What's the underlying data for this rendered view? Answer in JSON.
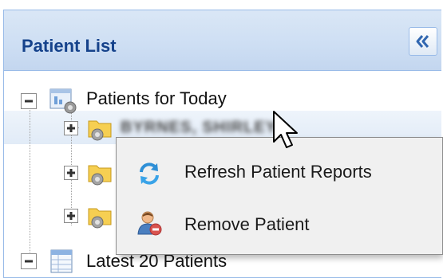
{
  "panel": {
    "title": "Patient List",
    "collapse_icon": "double-chevron-left-icon"
  },
  "tree": {
    "groups": [
      {
        "label": "Patients for Today",
        "expanded": true,
        "icon": "report-gear-icon"
      },
      {
        "label": "Latest 20 Patients",
        "expanded": true,
        "icon": "table-icon"
      }
    ],
    "patient_rows": [
      {
        "label": "BYRNES, SHIRLEY",
        "collapsed": true,
        "icon": "folder-gear-icon"
      },
      {
        "label": "",
        "collapsed": true,
        "icon": "folder-gear-icon"
      },
      {
        "label": "",
        "collapsed": true,
        "icon": "folder-gear-icon"
      }
    ]
  },
  "context_menu": {
    "items": [
      {
        "label": "Refresh Patient Reports",
        "icon": "refresh-icon"
      },
      {
        "label": "Remove Patient",
        "icon": "remove-user-icon"
      }
    ]
  },
  "colors": {
    "title": "#15428b",
    "header_bg": "#cddef3",
    "border": "#99bbe8",
    "menu_bg": "#f0f0f0"
  }
}
